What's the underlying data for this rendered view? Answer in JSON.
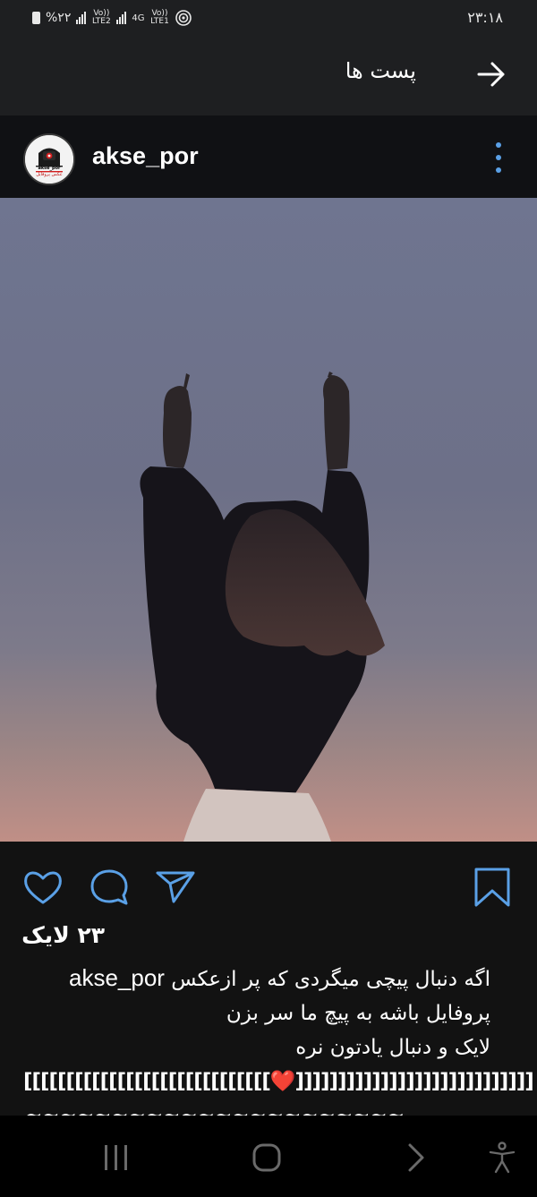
{
  "status_bar": {
    "battery": "%۲۲",
    "sim1": "Vo)) LTE2",
    "sim2_type": "4G",
    "sim2": "Vo)) LTE1",
    "time": "۲۳:۱۸",
    "icons": [
      "battery-icon",
      "signal-icon",
      "signal-icon",
      "hotspot-icon"
    ]
  },
  "header": {
    "title": "پست ها",
    "back_icon": "arrow-right-icon"
  },
  "post": {
    "username": "akse_por",
    "avatar_text_en": "akse_por",
    "avatar_text_fa": "عکس پروفایل",
    "likes": "۲۳ لایک",
    "caption": {
      "line1_user": "akse_por",
      "line1_text": "اگه دنبال پیچی میگردی که پر ازعکس",
      "line2": "پروفایل باشه به پیچ ما سر بزن",
      "line3": "لایک و دنبال یادتون نره",
      "line4_left": "[[[[[[[[[[[[[[[[[[[[[[[[[[[[[",
      "line4_heart": "❤️",
      "line4_right": "]]]]]]]]]]]]]]]]]]]]]]]]]]]]",
      "line5": "~~~~~~~~~~~~~~~~~~~~~~"
    }
  },
  "actions": {
    "icons": [
      "heart-icon",
      "comment-icon",
      "share-icon",
      "bookmark-icon"
    ],
    "accent": "#5aa0e6"
  },
  "nav": {
    "icons": [
      "recent-apps-icon",
      "home-icon",
      "back-icon",
      "accessibility-icon"
    ]
  }
}
